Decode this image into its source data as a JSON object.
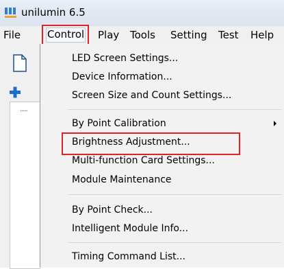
{
  "window": {
    "title": "unilumin 6.5"
  },
  "menubar": {
    "items": [
      {
        "label": "File"
      },
      {
        "label": "Control"
      },
      {
        "label": "Play"
      },
      {
        "label": "Tools"
      },
      {
        "label": "Setting"
      },
      {
        "label": "Test"
      },
      {
        "label": "Help"
      }
    ]
  },
  "dropdown": {
    "items": [
      {
        "label": "LED Screen Settings..."
      },
      {
        "label": "Device Information..."
      },
      {
        "label": "Screen Size and Count Settings..."
      },
      {
        "label": "By Point Calibration"
      },
      {
        "label": "Brightness Adjustment..."
      },
      {
        "label": "Multi-function Card Settings..."
      },
      {
        "label": "Module Maintenance"
      },
      {
        "label": "By Point Check..."
      },
      {
        "label": "Intelligent Module Info..."
      },
      {
        "label": "Timing Command List..."
      }
    ]
  },
  "icons": {
    "app": "app-icon",
    "new": "new-file-icon",
    "add": "plus-icon",
    "submenu": "chevron-right-icon"
  },
  "colors": {
    "highlight": "#e0202a",
    "plus": "#1a6fc9"
  }
}
